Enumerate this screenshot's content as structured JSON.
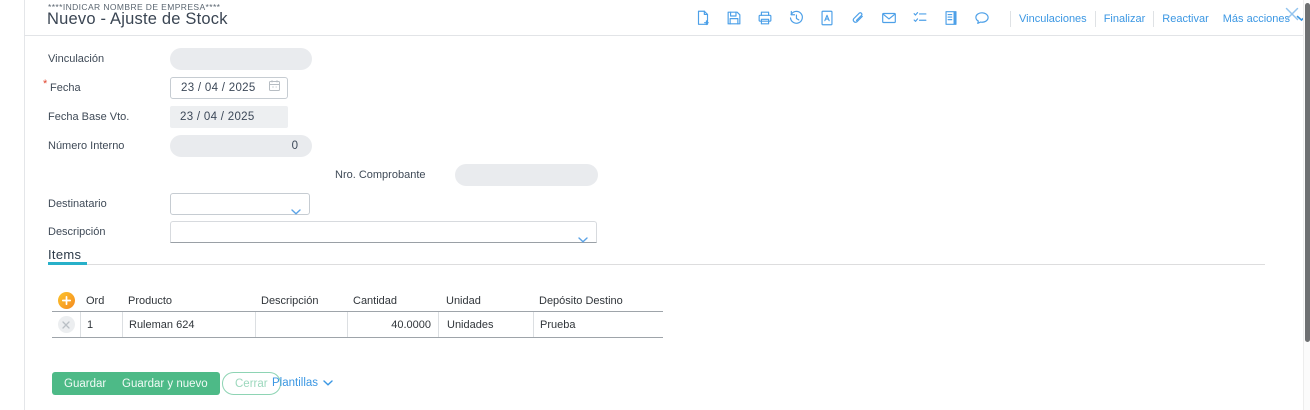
{
  "header": {
    "company": "****INDICAR NOMBRE DE EMPRESA****",
    "title": "Nuevo - Ajuste de Stock",
    "links": {
      "vinculaciones": "Vinculaciones",
      "finalizar": "Finalizar",
      "reactivar": "Reactivar",
      "mas_acciones": "Más acciones"
    }
  },
  "toolbar": {
    "icons": [
      "new-document",
      "save",
      "print",
      "history",
      "text-document",
      "attachment",
      "email",
      "checklist",
      "journal",
      "comment"
    ]
  },
  "form": {
    "fields": {
      "vinculacion": {
        "label": "Vinculación",
        "value": ""
      },
      "fecha": {
        "label": "Fecha",
        "required": true,
        "value": "23 / 04 / 2025"
      },
      "fecha_base": {
        "label": "Fecha Base Vto.",
        "value": "23 / 04 / 2025"
      },
      "numero_interno": {
        "label": "Número Interno",
        "value": "0"
      },
      "nro_comprobante": {
        "label": "Nro. Comprobante",
        "value": ""
      },
      "destinatario": {
        "label": "Destinatario",
        "value": ""
      },
      "descripcion": {
        "label": "Descripción",
        "value": ""
      }
    }
  },
  "items": {
    "tab_label": "Items",
    "table": {
      "columns": [
        "Ord",
        "Producto",
        "Descripción",
        "Cantidad",
        "Unidad",
        "Depósito Destino"
      ],
      "rows": [
        {
          "ord": "1",
          "producto": "Ruleman 624",
          "descripcion": "",
          "cantidad": "40.0000",
          "unidad": "Unidades",
          "deposito_destino": "Prueba"
        }
      ]
    }
  },
  "footer": {
    "guardar": "Guardar",
    "guardar_y_nuevo": "Guardar y nuevo",
    "cerrar": "Cerrar",
    "plantillas": "Plantillas"
  },
  "colors": {
    "accent_blue": "#3b97e3",
    "icon_blue": "#4da0e8",
    "button_green": "#4dba87",
    "tab_underline": "#28b0c9",
    "plus_orange": "#f58a20",
    "required_red": "#e0442e"
  }
}
